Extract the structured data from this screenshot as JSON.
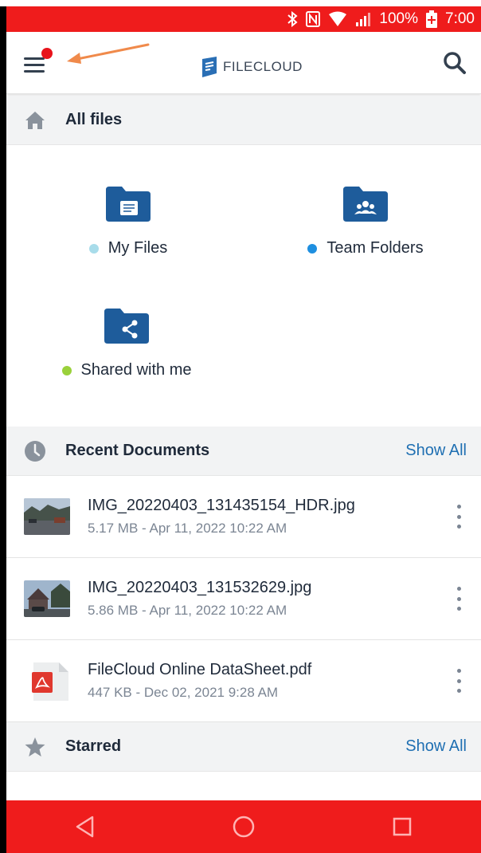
{
  "status_bar": {
    "battery": "100%",
    "time": "7:00",
    "icons": [
      "bluetooth-icon",
      "nfc-icon",
      "wifi-icon",
      "signal-icon",
      "battery-icon"
    ]
  },
  "app_bar": {
    "logo_text": "FILECLOUD",
    "icons": [
      "menu-icon",
      "search-icon"
    ],
    "notification_badge_color": "#e8131b",
    "annotation_arrow_color": "#f08a4b"
  },
  "all_files": {
    "title": "All files",
    "icon": "home-icon",
    "tiles": [
      {
        "label": "My Files",
        "icon": "folder-document-icon",
        "dot_color": "#a8dcea"
      },
      {
        "label": "Team Folders",
        "icon": "folder-team-icon",
        "dot_color": "#1e8fe0"
      },
      {
        "label": "Shared with me",
        "icon": "folder-share-icon",
        "dot_color": "#9ad13b"
      }
    ]
  },
  "recent_documents": {
    "title": "Recent Documents",
    "icon": "clock-icon",
    "show_all": "Show All",
    "items": [
      {
        "name": "IMG_20220403_131435154_HDR.jpg",
        "meta": "5.17 MB - Apr 11, 2022 10:22 AM",
        "thumb": "photo-street"
      },
      {
        "name": "IMG_20220403_131532629.jpg",
        "meta": "5.86 MB - Apr 11, 2022 10:22 AM",
        "thumb": "photo-house"
      },
      {
        "name": "FileCloud Online DataSheet.pdf",
        "meta": "447 KB - Dec 02, 2021 9:28 AM",
        "thumb": "pdf-icon"
      }
    ]
  },
  "starred": {
    "title": "Starred",
    "icon": "star-icon",
    "show_all": "Show All"
  },
  "nav_bar": {
    "icons": [
      "back-icon",
      "home-circle-icon",
      "recents-icon"
    ]
  },
  "colors": {
    "status_bar": "#ef1c1c",
    "folder_blue": "#1e5c9b",
    "link": "#1f6fb2"
  }
}
